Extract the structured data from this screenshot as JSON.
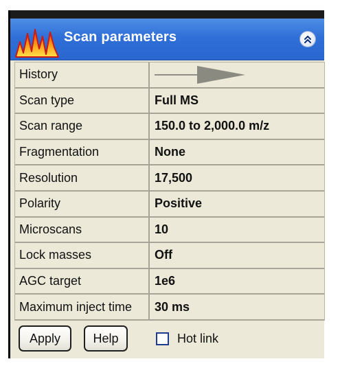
{
  "panel": {
    "title": "Scan parameters",
    "logo_icon": "peaks-icon",
    "collapse_icon": "double-chevron-up-icon",
    "colors": {
      "title_bar": "#2f6fd7",
      "panel_bg": "#ece9d8",
      "title_text": "#ffffff"
    }
  },
  "rows": [
    {
      "label": "History",
      "value": "",
      "value_icon": "history-arrow-icon"
    },
    {
      "label": "Scan type",
      "value": "Full MS"
    },
    {
      "label": "Scan range",
      "value": "150.0 to 2,000.0 m/z"
    },
    {
      "label": "Fragmentation",
      "value": "None"
    },
    {
      "label": "Resolution",
      "value": "17,500"
    },
    {
      "label": "Polarity",
      "value": "Positive"
    },
    {
      "label": "Microscans",
      "value": "10"
    },
    {
      "label": "Lock masses",
      "value": "Off"
    },
    {
      "label": "AGC target",
      "value": "1e6"
    },
    {
      "label": "Maximum inject time",
      "value": "30 ms"
    }
  ],
  "footer": {
    "apply_label": "Apply",
    "help_label": "Help",
    "hotlink_label": "Hot link",
    "hotlink_checked": false
  }
}
